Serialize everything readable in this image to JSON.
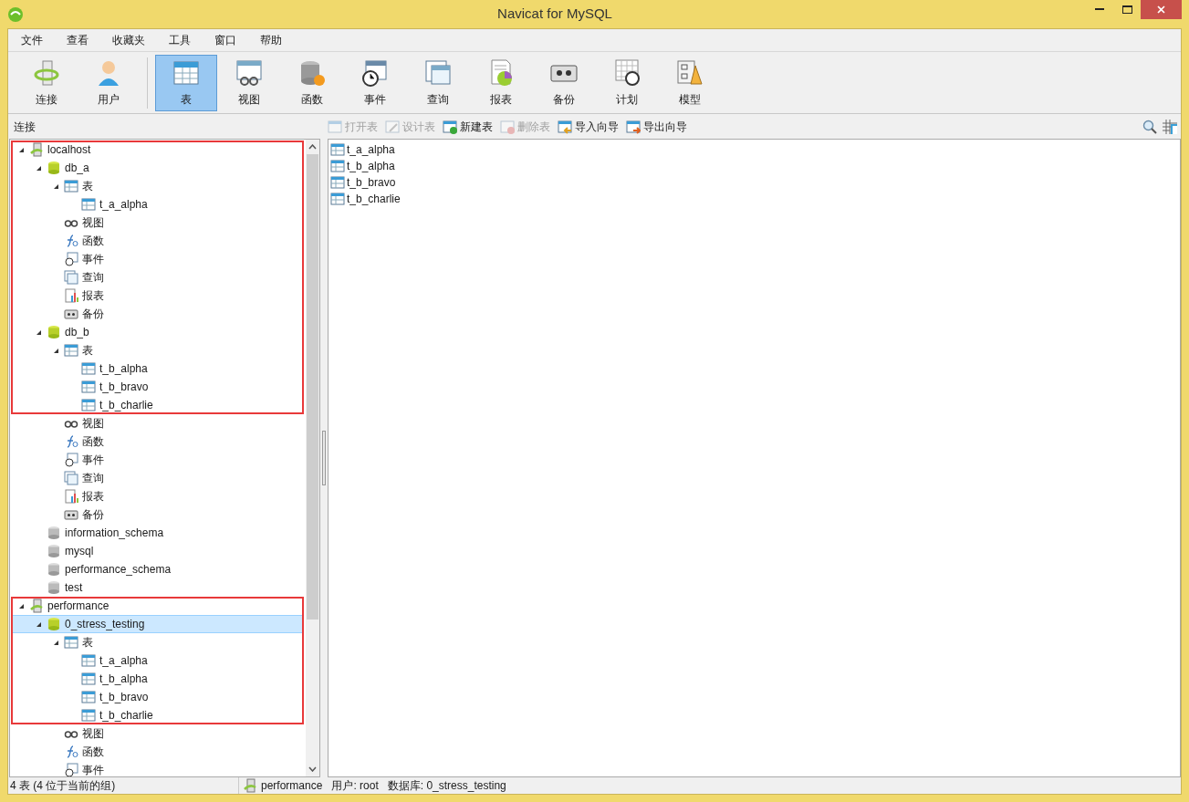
{
  "window": {
    "title": "Navicat for MySQL"
  },
  "menu": [
    "文件",
    "查看",
    "收藏夹",
    "工具",
    "窗口",
    "帮助"
  ],
  "toolbar": [
    {
      "label": "连接",
      "kind": "connection",
      "selected": false
    },
    {
      "label": "用户",
      "kind": "user",
      "selected": false
    },
    {
      "label": "表",
      "kind": "table",
      "selected": true
    },
    {
      "label": "视图",
      "kind": "view",
      "selected": false
    },
    {
      "label": "函数",
      "kind": "function",
      "selected": false
    },
    {
      "label": "事件",
      "kind": "event",
      "selected": false
    },
    {
      "label": "查询",
      "kind": "query",
      "selected": false
    },
    {
      "label": "报表",
      "kind": "report",
      "selected": false
    },
    {
      "label": "备份",
      "kind": "backup",
      "selected": false
    },
    {
      "label": "计划",
      "kind": "schedule",
      "selected": false
    },
    {
      "label": "模型",
      "kind": "model",
      "selected": false
    }
  ],
  "sidebar_title": "连接",
  "actions": [
    {
      "label": "打开表",
      "kind": "open",
      "disabled": true
    },
    {
      "label": "设计表",
      "kind": "design",
      "disabled": true
    },
    {
      "label": "新建表",
      "kind": "new",
      "disabled": false
    },
    {
      "label": "删除表",
      "kind": "delete",
      "disabled": true
    },
    {
      "label": "导入向导",
      "kind": "import",
      "disabled": false
    },
    {
      "label": "导出向导",
      "kind": "export",
      "disabled": false
    }
  ],
  "tree": [
    {
      "label": "localhost",
      "kind": "server",
      "expanded": true,
      "boxed": true,
      "selected": false,
      "children": [
        {
          "label": "db_a",
          "kind": "database",
          "expanded": true,
          "boxed": true,
          "selected": false,
          "children": [
            {
              "label": "表",
              "kind": "tables",
              "expanded": true,
              "boxed": true,
              "selected": false,
              "children": [
                {
                  "label": "t_a_alpha",
                  "kind": "table",
                  "boxed": true,
                  "selected": false
                }
              ]
            },
            {
              "label": "视图",
              "kind": "view",
              "boxed": true,
              "selected": false
            },
            {
              "label": "函数",
              "kind": "function",
              "boxed": true,
              "selected": false
            },
            {
              "label": "事件",
              "kind": "event",
              "boxed": true,
              "selected": false
            },
            {
              "label": "查询",
              "kind": "query",
              "boxed": true,
              "selected": false
            },
            {
              "label": "报表",
              "kind": "report",
              "boxed": true,
              "selected": false
            },
            {
              "label": "备份",
              "kind": "backup",
              "boxed": true,
              "selected": false
            }
          ]
        },
        {
          "label": "db_b",
          "kind": "database",
          "expanded": true,
          "boxed": true,
          "selected": false,
          "children": [
            {
              "label": "表",
              "kind": "tables",
              "expanded": true,
              "boxed": true,
              "selected": false,
              "children": [
                {
                  "label": "t_b_alpha",
                  "kind": "table",
                  "boxed": true,
                  "selected": false
                },
                {
                  "label": "t_b_bravo",
                  "kind": "table",
                  "boxed": true,
                  "selected": false
                },
                {
                  "label": "t_b_charlie",
                  "kind": "table",
                  "boxed": true,
                  "selected": false
                }
              ]
            },
            {
              "label": "视图",
              "kind": "view",
              "boxed": false,
              "selected": false
            },
            {
              "label": "函数",
              "kind": "function",
              "boxed": false,
              "selected": false
            },
            {
              "label": "事件",
              "kind": "event",
              "boxed": false,
              "selected": false
            },
            {
              "label": "查询",
              "kind": "query",
              "boxed": false,
              "selected": false
            },
            {
              "label": "报表",
              "kind": "report",
              "boxed": false,
              "selected": false
            },
            {
              "label": "备份",
              "kind": "backup",
              "boxed": false,
              "selected": false
            }
          ]
        },
        {
          "label": "information_schema",
          "kind": "database_closed",
          "boxed": false,
          "selected": false
        },
        {
          "label": "mysql",
          "kind": "database_closed",
          "boxed": false,
          "selected": false
        },
        {
          "label": "performance_schema",
          "kind": "database_closed",
          "boxed": false,
          "selected": false
        },
        {
          "label": "test",
          "kind": "database_closed",
          "boxed": false,
          "selected": false
        }
      ]
    },
    {
      "label": "performance",
      "kind": "server",
      "expanded": true,
      "boxed": true,
      "selected": false,
      "children": [
        {
          "label": "0_stress_testing",
          "kind": "database",
          "expanded": true,
          "boxed": true,
          "selected": true,
          "children": [
            {
              "label": "表",
              "kind": "tables",
              "expanded": true,
              "boxed": true,
              "selected": false,
              "children": [
                {
                  "label": "t_a_alpha",
                  "kind": "table",
                  "boxed": true,
                  "selected": false
                },
                {
                  "label": "t_b_alpha",
                  "kind": "table",
                  "boxed": true,
                  "selected": false
                },
                {
                  "label": "t_b_bravo",
                  "kind": "table",
                  "boxed": true,
                  "selected": false
                },
                {
                  "label": "t_b_charlie",
                  "kind": "table",
                  "boxed": true,
                  "selected": false
                }
              ]
            },
            {
              "label": "视图",
              "kind": "view",
              "boxed": false,
              "selected": false
            },
            {
              "label": "函数",
              "kind": "function",
              "boxed": false,
              "selected": false
            },
            {
              "label": "事件",
              "kind": "event",
              "boxed": false,
              "selected": false
            }
          ]
        }
      ]
    }
  ],
  "objects": [
    "t_a_alpha",
    "t_b_alpha",
    "t_b_bravo",
    "t_b_charlie"
  ],
  "status_bar": {
    "count": "4 表 (4 位于当前的组)",
    "connection": "performance",
    "user": "用户: root",
    "database": "数据库: 0_stress_testing"
  }
}
